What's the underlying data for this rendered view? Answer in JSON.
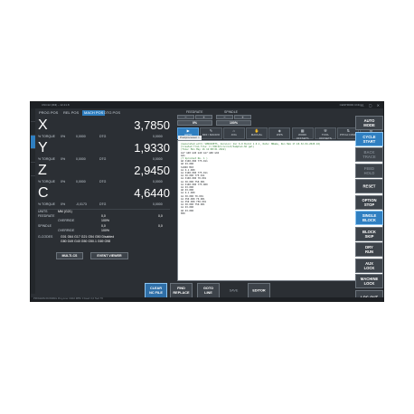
{
  "window": {
    "title": "CNC12 (Mill) – 12.21.8",
    "right_label": "CENTROID CNC12",
    "controls": "— ▢ ✕"
  },
  "tabs_header": {
    "prog_pos": "PROG POS",
    "rel_pos": "REL POS",
    "machine_pos": "MACH POS",
    "dtg_pos": "DTG POS"
  },
  "axes": [
    {
      "name": "X",
      "value": "3,7850",
      "torque_label": "% TORQUE",
      "torque": "0%",
      "s1": "0,0000",
      "dtg_label": "DTG",
      "s2": "0,0000"
    },
    {
      "name": "Y",
      "value": "1,9330",
      "torque_label": "% TORQUE",
      "torque": "0%",
      "s1": "0,0000",
      "dtg_label": "DTG",
      "s2": "0,0000"
    },
    {
      "name": "Z",
      "value": "2,9450",
      "torque_label": "% TORQUE",
      "torque": "0%",
      "s1": "0,0000",
      "dtg_label": "DTG",
      "s2": "0,0000"
    },
    {
      "name": "C",
      "value": "4,6440",
      "torque_label": "% TORQUE",
      "torque": "0%",
      "s1": "-0,0173",
      "dtg_label": "DTG",
      "s2": "0,0000"
    }
  ],
  "info": {
    "units_label": "UNITS",
    "units": "MM (G21)",
    "feedrate_label": "FEEDRATE",
    "feedrate_val": "0,0",
    "feedrate_act": "0,0",
    "override_label": "OVERRIDE",
    "override_val": "100%",
    "spindle_label": "SPINDLE",
    "spindle_val": "0,0",
    "spindle_act": "0,0",
    "spindle_override_val": "100%",
    "gcodes_label": "G-CODES",
    "gcodes_line1": "G01 G64 G17 G21 G54 G50 Disabled",
    "gcodes_line2": "G80 G49 G40 G50 G50.1 G69 G98"
  },
  "left_buttons": {
    "multi_cs": "MULTI-CS",
    "event_viewer": "EVENT VIEWER"
  },
  "feed_panel": {
    "feedrate_label": "FEEDRATE",
    "spindle_label": "SPINDLE",
    "minus": "−",
    "plus": "+",
    "feed_pct": "0%",
    "feed_pct2": "100%",
    "spindle_pct": "100%"
  },
  "toolbar": [
    {
      "icon": "▶",
      "label": "AUTO",
      "active": true
    },
    {
      "icon": "✎",
      "label": "MDI / MACRO"
    },
    {
      "icon": "⌂",
      "label": "JOG"
    },
    {
      "icon": "✋",
      "label": "MANUAL"
    },
    {
      "icon": "◈",
      "label": "WPS"
    },
    {
      "icon": "▦",
      "label": "WORK OFFSETS"
    },
    {
      "icon": "⚒",
      "label": "TOOL OFFSETS"
    },
    {
      "icon": "⇅",
      "label": "PITCH COMP"
    },
    {
      "icon": "⚙",
      "label": "NUMBER CS"
    }
  ],
  "editor": {
    "tab_label": "Postprocessor ×",
    "lines": [
      "(Generated with: SPROCKETS, Version: Ver 6.0 Build 1.0.1, Date: 8Name, Run Ham 17.18.32.04.2020.16)",
      "(Created from file: C:/CNC12/cncroot/Sample1.NC gal)",
      "(Time: Mon May 16 12:08:01 2022)",
      "G17 G90 G40 G49 G17 G80 G94",
      "G21",
      "",
      "(T Sprocket No. 1 )",
      "G0 X100.000 Y75.011",
      "G0 Z3.000",
      "S1000 M03",
      "",
      "G1 Z-1.000",
      "G1 X100.000 Y75.011",
      "G1 X0.000 Y75.011",
      "G1 X100.000 Y0.001",
      "G1 X0.000 Y50.001",
      "G1 X100.000 Y75.000",
      "G1 Z3.000",
      "",
      "G0 Z3.000",
      "G1 Z-1.000",
      "G1 X0.000 Y0.001",
      "G1 X50.000 Y0.001",
      "G1 X50.000 Y50.001",
      "G1 X0.000 Y50.001",
      "G1 Z3.000",
      "",
      "G0 Z3.000",
      "M30"
    ]
  },
  "right_buttons": [
    {
      "label1": "AUTO",
      "label2": "MODE",
      "style": "normal"
    },
    {
      "label1": "CYCLE",
      "label2": "START",
      "style": "blue"
    },
    {
      "label1": "BACK",
      "label2": "TRACE",
      "style": "dim"
    },
    {
      "label1": "FEED",
      "label2": "HOLD",
      "style": "dim"
    },
    {
      "label1": "RESET",
      "label2": "",
      "style": "normal"
    },
    {
      "label1": "OPTION",
      "label2": "STOP",
      "style": "normal"
    },
    {
      "label1": "SINGLE",
      "label2": "BLOCK",
      "style": "blue"
    },
    {
      "label1": "BLOCK",
      "label2": "SKIP",
      "style": "normal"
    },
    {
      "label1": "DRY",
      "label2": "RUN",
      "style": "normal"
    },
    {
      "label1": "AUX",
      "label2": "LOCK",
      "style": "normal"
    },
    {
      "label1": "MACHINE",
      "label2": "LOCK",
      "style": "normal"
    },
    {
      "label1": "LOG OUT",
      "label2": "",
      "style": "normal"
    }
  ],
  "bottom_buttons": [
    {
      "label1": "CLEAR",
      "label2": "NC FILE",
      "style": "blue"
    },
    {
      "label1": "FIND",
      "label2": "REPLACE",
      "style": "normal"
    },
    {
      "label1": "GOTO",
      "label2": "LINE",
      "style": "normal"
    },
    {
      "label1": "SAVE",
      "label2": "",
      "style": "dim"
    },
    {
      "label1": "EDITOR",
      "label2": "",
      "style": "normal"
    }
  ],
  "status": "PROGRAM RUNNING   Prog Line: 0/210   RPM: 0   Feed: 0,0   Tool: T0"
}
